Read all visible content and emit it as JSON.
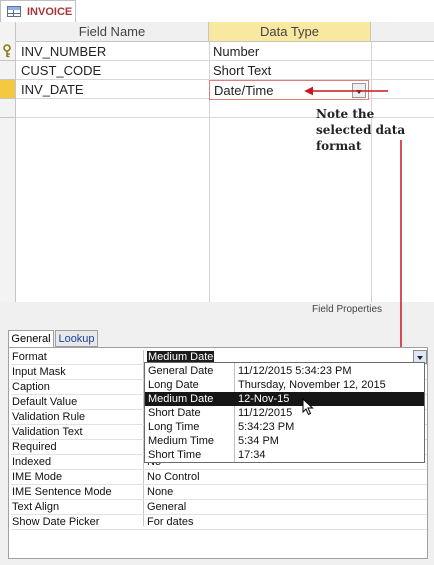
{
  "tab": {
    "title": "INVOICE",
    "icon": "table-icon"
  },
  "grid": {
    "headers": {
      "field_name": "Field Name",
      "data_type": "Data Type"
    },
    "rows": [
      {
        "field": "INV_NUMBER",
        "type": "Number",
        "primary_key": true
      },
      {
        "field": "CUST_CODE",
        "type": "Short Text"
      },
      {
        "field": "INV_DATE",
        "type": "Date/Time",
        "selected": true
      }
    ]
  },
  "annotation": {
    "text": "Note the selected data format",
    "color": "#c8181e"
  },
  "field_properties": {
    "label": "Field Properties",
    "tabs": [
      {
        "label": "General",
        "active": true
      },
      {
        "label": "Lookup"
      }
    ],
    "rows": [
      {
        "name": "Format",
        "value": "Medium Date"
      },
      {
        "name": "Input Mask",
        "value": ""
      },
      {
        "name": "Caption",
        "value": ""
      },
      {
        "name": "Default Value",
        "value": ""
      },
      {
        "name": "Validation Rule",
        "value": ""
      },
      {
        "name": "Validation Text",
        "value": ""
      },
      {
        "name": "Required",
        "value": ""
      },
      {
        "name": "Indexed",
        "value": "No"
      },
      {
        "name": "IME Mode",
        "value": "No Control"
      },
      {
        "name": "IME Sentence Mode",
        "value": "None"
      },
      {
        "name": "Text Align",
        "value": "General"
      },
      {
        "name": "Show Date Picker",
        "value": "For dates"
      }
    ],
    "format_options": [
      {
        "name": "General Date",
        "example": "11/12/2015 5:34:23 PM"
      },
      {
        "name": "Long Date",
        "example": "Thursday, November 12, 2015"
      },
      {
        "name": "Medium Date",
        "example": "12-Nov-15",
        "selected": true
      },
      {
        "name": "Short Date",
        "example": "11/12/2015"
      },
      {
        "name": "Long Time",
        "example": "5:34:23 PM"
      },
      {
        "name": "Medium Time",
        "example": "5:34 PM"
      },
      {
        "name": "Short Time",
        "example": "17:34"
      }
    ]
  }
}
